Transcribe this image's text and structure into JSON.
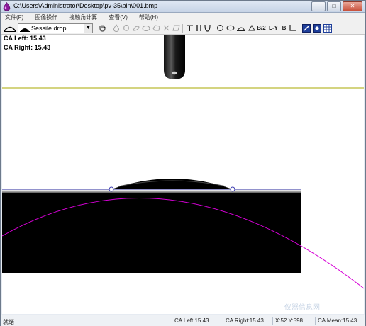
{
  "window": {
    "title": "C:\\Users\\Administrator\\Desktop\\pv-35\\bin\\001.bmp",
    "minimize_glyph": "─",
    "maximize_glyph": "□",
    "close_glyph": "✕"
  },
  "menu": {
    "items": [
      "文件(F)",
      "图像操作",
      "接触角计算",
      "查看(V)",
      "帮助(H)"
    ]
  },
  "toolbar": {
    "mode_value": "Sessile drop",
    "text_tools": [
      "B/2",
      "L-Y",
      "B"
    ]
  },
  "measurements": {
    "ca_left_label": "CA Left: 15.43",
    "ca_right_label": "CA Right: 15.43"
  },
  "statusbar": {
    "ready": "就绪",
    "ca_left": "CA Left:15.43",
    "ca_right": "CA Right:15.43",
    "xy": "X:52 Y:598",
    "ca_mean": "CA Mean:15.43"
  },
  "watermark": "仪器信息网",
  "colors": {
    "baseline": "#3a3ab0",
    "circle_fit": "#d600d6",
    "reference_line": "#a8a800",
    "substrate": "#000000"
  }
}
